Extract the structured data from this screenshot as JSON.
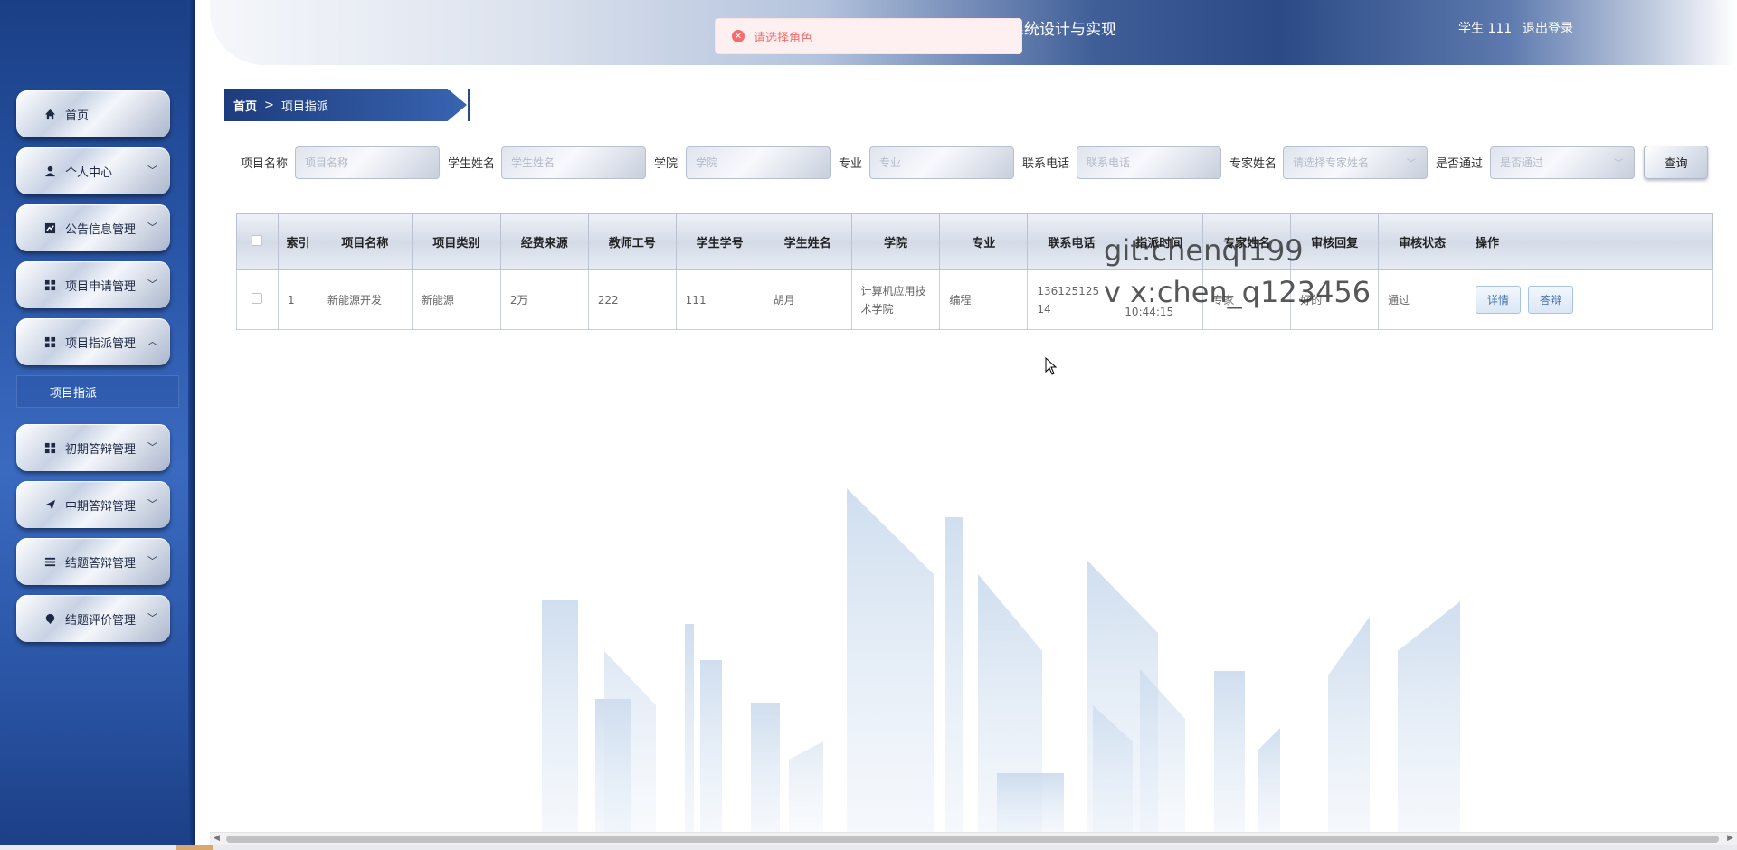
{
  "header": {
    "title": "系统设计与实现",
    "user": "学生 111",
    "logout": "退出登录"
  },
  "toast": {
    "message": "请选择角色",
    "icon": "error-circle-icon"
  },
  "sidebar": {
    "items": [
      {
        "label": "首页",
        "icon": "home-icon"
      },
      {
        "label": "个人中心",
        "icon": "user-icon"
      },
      {
        "label": "公告信息管理",
        "icon": "chart-icon"
      },
      {
        "label": "项目申请管理",
        "icon": "grid-icon"
      },
      {
        "label": "项目指派管理",
        "icon": "grid-icon"
      },
      {
        "label": "初期答辩管理",
        "icon": "grid-icon"
      },
      {
        "label": "中期答辩管理",
        "icon": "send-icon"
      },
      {
        "label": "结题答辩管理",
        "icon": "list-icon"
      },
      {
        "label": "结题评价管理",
        "icon": "pin-icon"
      }
    ],
    "submenu": {
      "label": "项目指派"
    }
  },
  "breadcrumb": {
    "home": "首页",
    "separator": ">",
    "current": "项目指派"
  },
  "search": {
    "fields": [
      {
        "label": "项目名称",
        "placeholder": "项目名称"
      },
      {
        "label": "学生姓名",
        "placeholder": "学生姓名"
      },
      {
        "label": "学院",
        "placeholder": "学院"
      },
      {
        "label": "专业",
        "placeholder": "专业"
      },
      {
        "label": "联系电话",
        "placeholder": "联系电话"
      },
      {
        "label": "专家姓名",
        "placeholder": "请选择专家姓名"
      },
      {
        "label": "是否通过",
        "placeholder": "是否通过"
      }
    ],
    "button": "查询"
  },
  "table": {
    "headers": [
      "索引",
      "项目名称",
      "项目类别",
      "经费来源",
      "教师工号",
      "学生学号",
      "学生姓名",
      "学院",
      "专业",
      "联系电话",
      "指派时间",
      "专家姓名",
      "审核回复",
      "审核状态",
      "操作"
    ],
    "rows": [
      {
        "index": "1",
        "project_name": "新能源开发",
        "project_type": "新能源",
        "funding": "2万",
        "teacher_id": "222",
        "student_id": "111",
        "student_name": "胡月",
        "college": "计算机应用技术学院",
        "major": "编程",
        "phone": "13612512514",
        "assign_time": "10:44:15",
        "expert_name": "专家",
        "review_reply": "好的",
        "review_status": "通过",
        "actions": [
          "详情",
          "答辩"
        ]
      }
    ]
  },
  "watermark": {
    "line1": "git:chenqi199",
    "line2": "v x:chen_q123456"
  },
  "colors": {
    "sidebar": "#2a56a8",
    "header_dark": "#2b4a86",
    "toast_text": "#f56c6c",
    "link": "#3c6eb0"
  }
}
